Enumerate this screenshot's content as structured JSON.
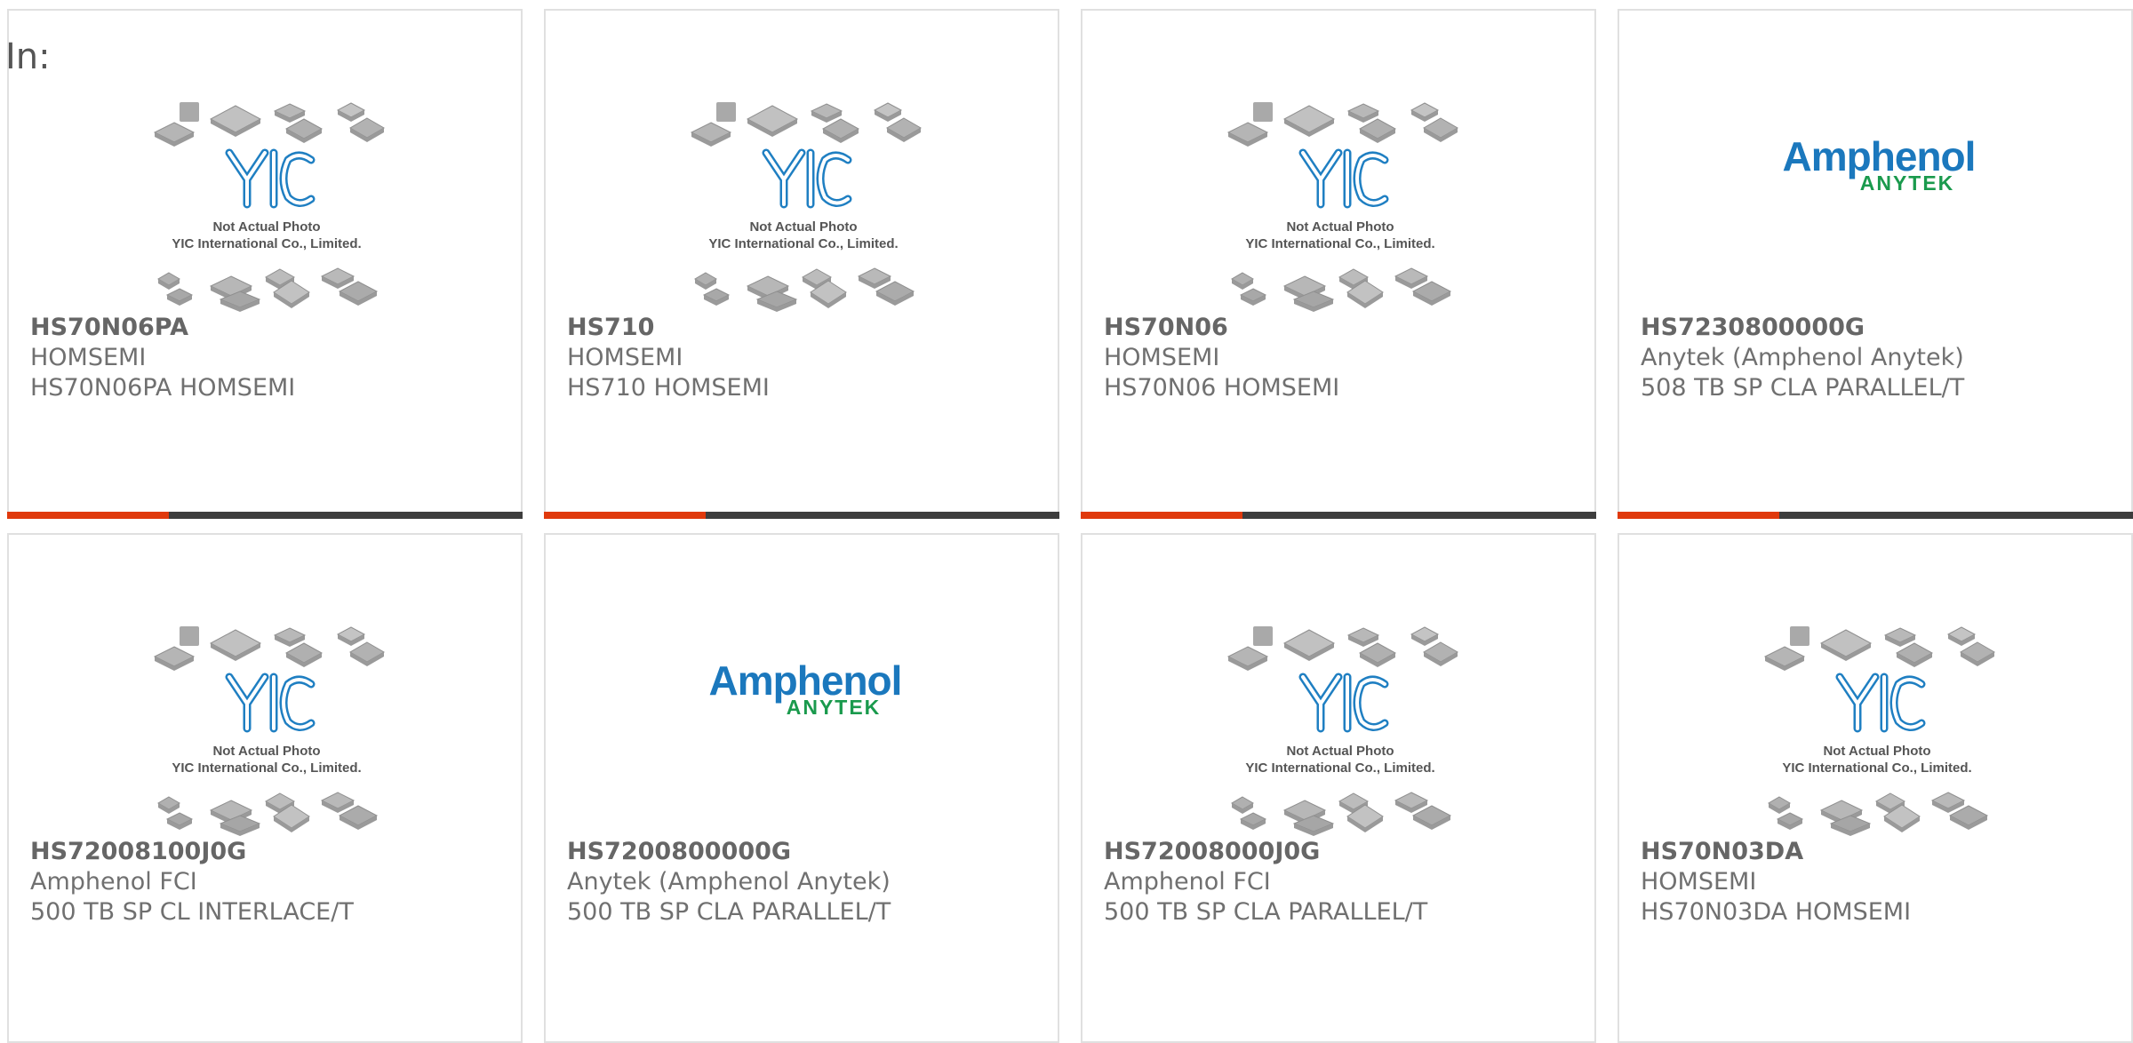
{
  "header": {
    "in_label": "In:"
  },
  "placeholder": {
    "not_actual_photo": "Not Actual Photo",
    "company": "YIC International Co., Limited."
  },
  "logo": {
    "brand": "Amphenol",
    "sub": "ANYTEK"
  },
  "colors": {
    "accent_bar": "#e0390c",
    "dark_bar": "#3d3d3d",
    "yic_blue": "#1f7fc2",
    "amphenol_blue": "#1b78bd",
    "anytek_green": "#1a9a4d"
  },
  "products": [
    {
      "pn": "HS70N06PA",
      "mfr": "HOMSEMI",
      "desc": "HS70N06PA HOMSEMI",
      "image": "yic-placeholder-image"
    },
    {
      "pn": "HS710",
      "mfr": "HOMSEMI",
      "desc": "HS710 HOMSEMI",
      "image": "yic-placeholder-image"
    },
    {
      "pn": "HS70N06",
      "mfr": "HOMSEMI",
      "desc": "HS70N06 HOMSEMI",
      "image": "yic-placeholder-image"
    },
    {
      "pn": "HS7230800000G",
      "mfr": "Anytek (Amphenol Anytek)",
      "desc": "508 TB SP CLA PARALLEL/T",
      "image": "amphenol-anytek-logo"
    },
    {
      "pn": "HS72008100J0G",
      "mfr": "Amphenol FCI",
      "desc": "500 TB SP CL INTERLACE/T",
      "image": "yic-placeholder-image"
    },
    {
      "pn": "HS7200800000G",
      "mfr": "Anytek (Amphenol Anytek)",
      "desc": "500 TB SP CLA PARALLEL/T",
      "image": "amphenol-anytek-logo"
    },
    {
      "pn": "HS72008000J0G",
      "mfr": "Amphenol FCI",
      "desc": "500 TB SP CLA PARALLEL/T",
      "image": "yic-placeholder-image"
    },
    {
      "pn": "HS70N03DA",
      "mfr": "HOMSEMI",
      "desc": "HS70N03DA HOMSEMI",
      "image": "yic-placeholder-image"
    }
  ]
}
